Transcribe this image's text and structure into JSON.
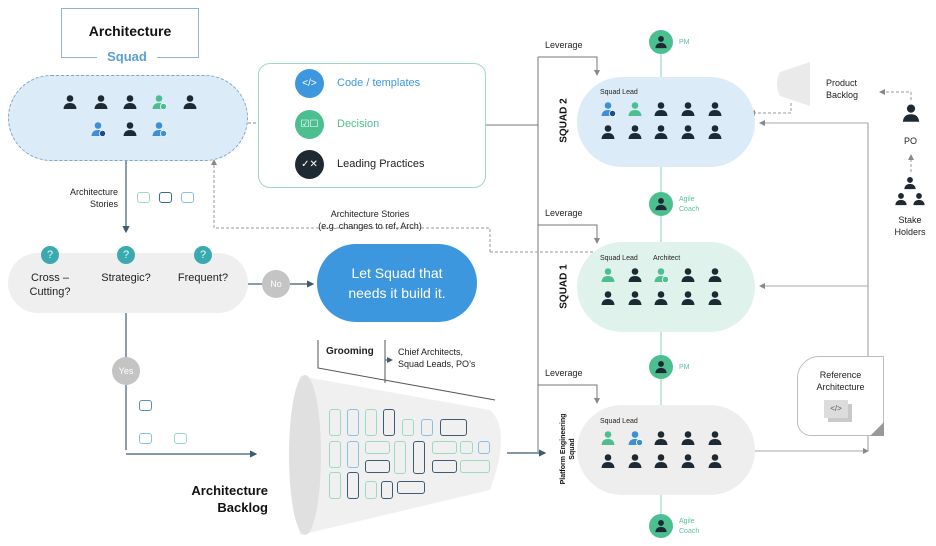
{
  "architecture_squad": {
    "title": "Architecture",
    "subtitle": "Squad",
    "members": [
      "person",
      "person",
      "person",
      "person-settings-green",
      "person",
      "person-settings-blue",
      "person",
      "person-add-blue"
    ]
  },
  "tools": {
    "items": [
      {
        "label": "Code / templates",
        "icon": "code-icon",
        "color": "#3d97de"
      },
      {
        "label": "Decision",
        "icon": "checkbox-icon",
        "color": "#4cbf90"
      },
      {
        "label": "Leading Practices",
        "icon": "check-x-icon",
        "color": "#1e2a33"
      }
    ]
  },
  "architecture_stories_label": "Architecture\nStories",
  "architecture_stories_line1": "Architecture",
  "architecture_stories_line2": "Stories",
  "questions": [
    {
      "label1": "Cross –",
      "label2": "Cutting?"
    },
    {
      "label1": "Strategic?",
      "label2": ""
    },
    {
      "label1": "Frequent?",
      "label2": ""
    }
  ],
  "question_icon": "?",
  "no_label": "No",
  "yes_label": "Yes",
  "let_squad": {
    "line1": "Let Squad that",
    "line2": "needs it build it."
  },
  "arch_stories_note": {
    "line1": "Architecture Stories",
    "line2": "(e.g. changes to ref, Arch)"
  },
  "grooming": {
    "label": "Grooming",
    "who_line1": "Chief Architects,",
    "who_line2": "Squad Leads, PO’s"
  },
  "architecture_backlog": {
    "line1": "Architecture",
    "line2": "Backlog"
  },
  "leverage_label": "Leverage",
  "squads": [
    {
      "name": "SQUAD 2",
      "role_labels": [
        "Squad Lead"
      ],
      "top_role": "PM",
      "bottom_role": {
        "line1": "Agile",
        "line2": "Coach"
      },
      "color": "#dcebf8"
    },
    {
      "name": "SQUAD 1",
      "role_labels": [
        "Squad Lead",
        "Architect"
      ],
      "top_role": "",
      "bottom_role": {
        "line1": "PM",
        "line2": ""
      },
      "color": "#dff3ec"
    },
    {
      "name": "Platform Engineering Squad",
      "name_line1": "Platform Engineering",
      "name_line2": "Squad",
      "role_labels": [
        "Squad Lead"
      ],
      "bottom_role": {
        "line1": "Agile",
        "line2": "Coach"
      },
      "color": "#eeeeee"
    }
  ],
  "product_backlog": {
    "line1": "Product",
    "line2": "Backlog"
  },
  "po_label": "PO",
  "stakeholders": {
    "line1": "Stake",
    "line2": "Holders"
  },
  "reference_architecture": {
    "line1": "Reference",
    "line2": "Architecture",
    "icon": "code-icon"
  },
  "colors": {
    "blue": "#3d97de",
    "green": "#4cbf90",
    "dark": "#1e2a33",
    "line": "#3f5a73",
    "gray": "#c4c4c4"
  }
}
